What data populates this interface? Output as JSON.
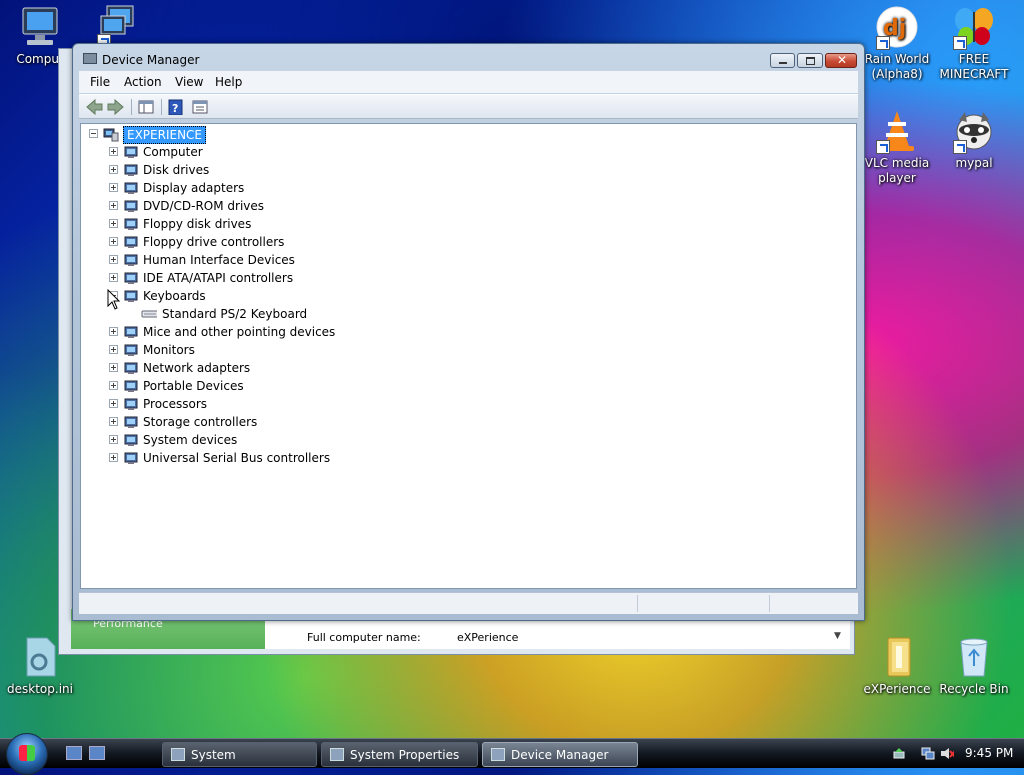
{
  "desktop": {
    "icons": [
      {
        "label": "Comput",
        "name": "computer-desktop-icon"
      },
      {
        "label": "Rain World (Alpha8)",
        "name": "rain-world-desktop-icon"
      },
      {
        "label": "FREE MINECRAFT",
        "name": "free-minecraft-desktop-icon"
      },
      {
        "label": "VLC media player",
        "name": "vlc-desktop-icon"
      },
      {
        "label": "mypal",
        "name": "mypal-desktop-icon"
      },
      {
        "label": "desktop.ini",
        "name": "desktop-ini-icon"
      },
      {
        "label": "eXPerience",
        "name": "experience-folder-icon"
      },
      {
        "label": "Recycle Bin",
        "name": "recycle-bin-icon"
      }
    ]
  },
  "system_window": {
    "performance": "Performance",
    "full_computer_name_label": "Full computer name:",
    "full_computer_name_value": "eXPerience"
  },
  "device_manager": {
    "title": "Device Manager",
    "menu": [
      "File",
      "Action",
      "View",
      "Help"
    ],
    "tree": {
      "root": "EXPERIENCE",
      "categories": [
        {
          "label": "Computer",
          "icon": "computer-icon",
          "expanded": false
        },
        {
          "label": "Disk drives",
          "icon": "disk-drive-icon",
          "expanded": false
        },
        {
          "label": "Display adapters",
          "icon": "display-adapter-icon",
          "expanded": false
        },
        {
          "label": "DVD/CD-ROM drives",
          "icon": "dvd-drive-icon",
          "expanded": false
        },
        {
          "label": "Floppy disk drives",
          "icon": "floppy-drive-icon",
          "expanded": false
        },
        {
          "label": "Floppy drive controllers",
          "icon": "floppy-controller-icon",
          "expanded": false
        },
        {
          "label": "Human Interface Devices",
          "icon": "hid-icon",
          "expanded": false
        },
        {
          "label": "IDE ATA/ATAPI controllers",
          "icon": "ide-controller-icon",
          "expanded": false
        },
        {
          "label": "Keyboards",
          "icon": "keyboard-icon",
          "expanded": true,
          "children": [
            "Standard PS/2 Keyboard"
          ]
        },
        {
          "label": "Mice and other pointing devices",
          "icon": "mouse-icon",
          "expanded": false
        },
        {
          "label": "Monitors",
          "icon": "monitor-icon",
          "expanded": false
        },
        {
          "label": "Network adapters",
          "icon": "network-adapter-icon",
          "expanded": false
        },
        {
          "label": "Portable Devices",
          "icon": "portable-device-icon",
          "expanded": false
        },
        {
          "label": "Processors",
          "icon": "processor-icon",
          "expanded": false
        },
        {
          "label": "Storage controllers",
          "icon": "storage-controller-icon",
          "expanded": false
        },
        {
          "label": "System devices",
          "icon": "system-devices-icon",
          "expanded": false
        },
        {
          "label": "Universal Serial Bus controllers",
          "icon": "usb-icon",
          "expanded": false
        }
      ]
    }
  },
  "taskbar": {
    "buttons": [
      {
        "label": "System",
        "active": false
      },
      {
        "label": "System Properties",
        "active": false
      },
      {
        "label": "Device Manager",
        "active": true
      }
    ],
    "clock": "9:45 PM"
  },
  "colors": {
    "selection": "#3399ff",
    "close_button": "#c84b34",
    "taskbar": "#121820"
  }
}
